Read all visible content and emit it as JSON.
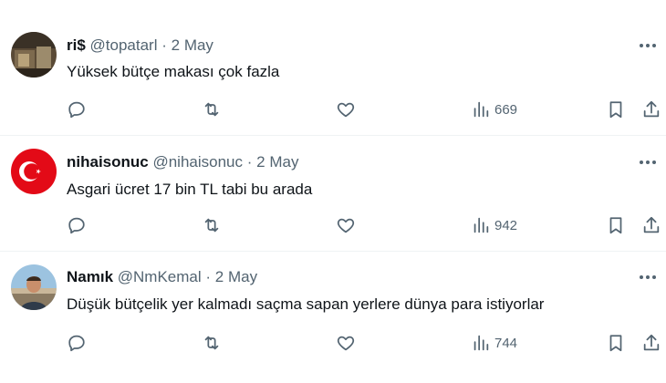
{
  "tweets": [
    {
      "name": "ri$",
      "handle": "@topatarl",
      "dot": "·",
      "date": "2 May",
      "text": "Yüksek bütçe makası çok fazla",
      "views": "669",
      "avatar": "photo-avatar"
    },
    {
      "name": "nihaisonuc",
      "handle": "@nihaisonuc",
      "dot": "·",
      "date": "2 May",
      "text": "Asgari ücret 17 bin TL tabi bu arada",
      "views": "942",
      "avatar": "turkish-flag-avatar"
    },
    {
      "name": "Namık",
      "handle": "@NmKemal",
      "dot": "·",
      "date": "2 May",
      "text": "Düşük bütçelik yer kalmadı saçma sapan yerlere dünya para istiyorlar",
      "views": "744",
      "avatar": "person-photo-avatar"
    }
  ],
  "icons": {
    "reply": "reply-icon",
    "retweet": "retweet-icon",
    "like": "heart-icon",
    "views": "views-chart-icon",
    "bookmark": "bookmark-icon",
    "share": "share-icon",
    "more": "more-icon"
  },
  "colors": {
    "text": "#0f1419",
    "secondary": "#536471",
    "divider": "#eff3f4",
    "flag_red": "#e30a17"
  }
}
